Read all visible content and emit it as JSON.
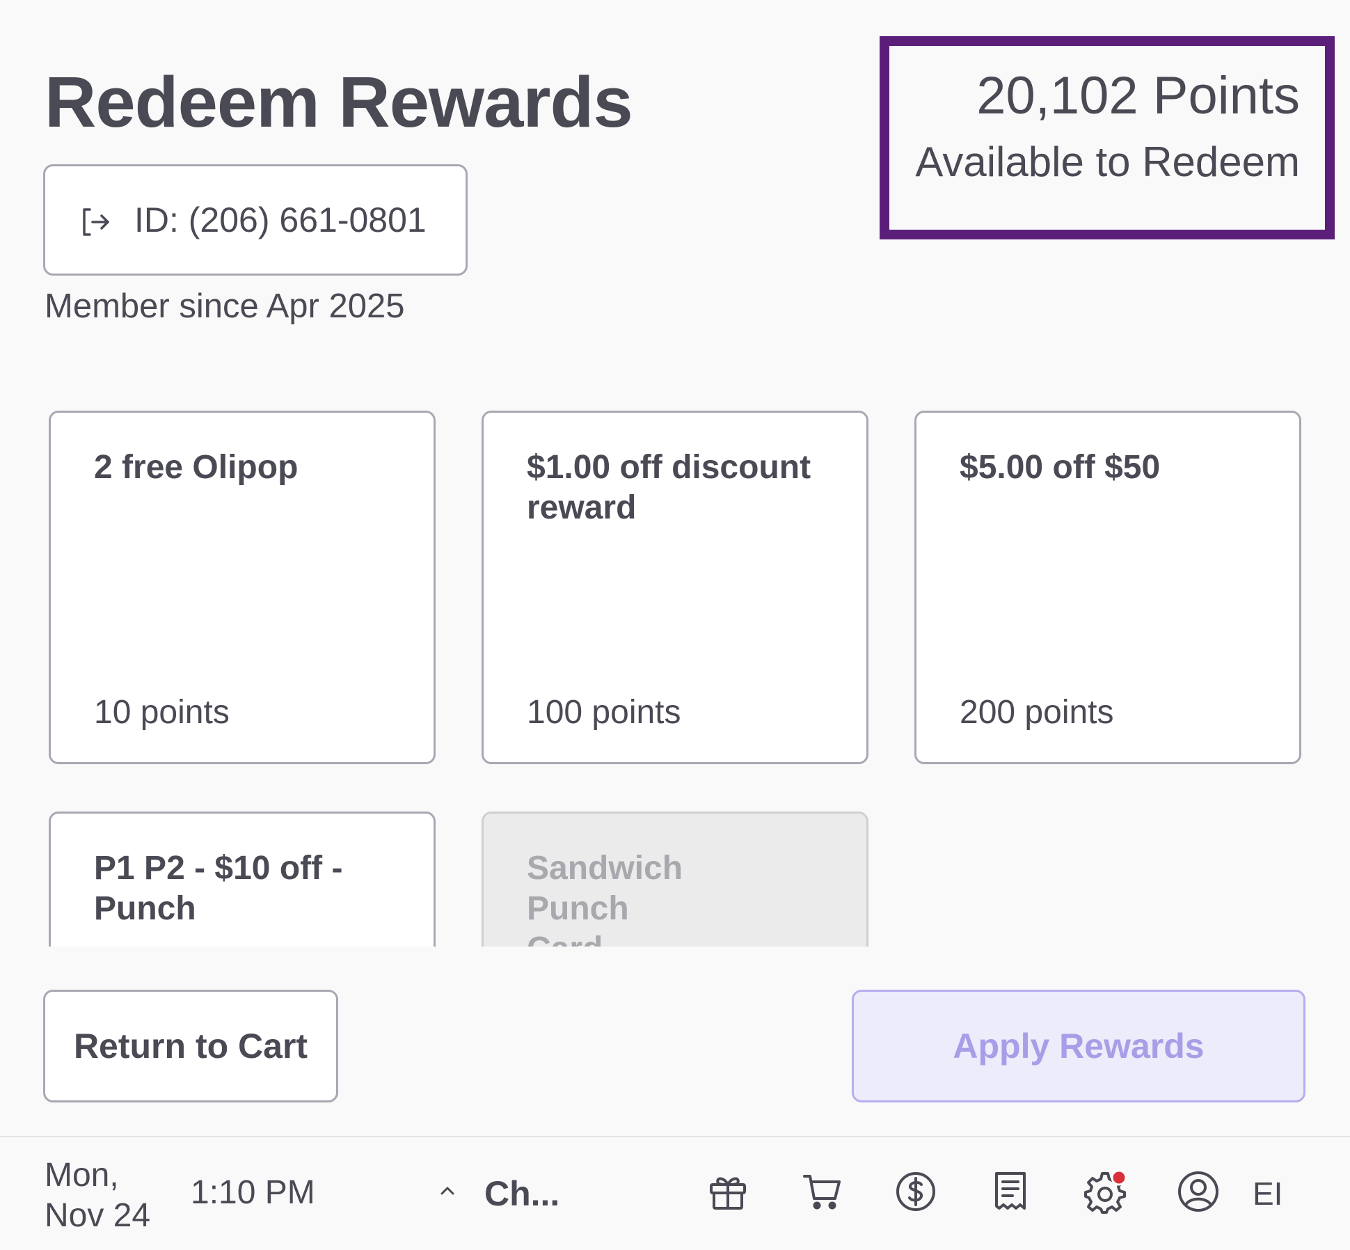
{
  "header": {
    "title": "Redeem Rewards",
    "member_id": "ID: (206) 661-0801",
    "member_since": "Member since Apr 2025"
  },
  "points": {
    "value": "20,102 Points",
    "label": "Available to Redeem",
    "accent_color": "#5b1f7a"
  },
  "rewards": [
    {
      "name": "2 free Olipop",
      "points": "10 points",
      "enabled": true
    },
    {
      "name": "$1.00 off discount reward",
      "points": "100 points",
      "enabled": true
    },
    {
      "name": "$5.00 off $50",
      "points": "200 points",
      "enabled": true
    },
    {
      "name": "P1 P2 - $10 off - Punch",
      "points": "",
      "enabled": true
    },
    {
      "name": "Sandwich Punch Card",
      "points": "",
      "enabled": false
    }
  ],
  "actions": {
    "return_label": "Return to Cart",
    "apply_label": "Apply Rewards"
  },
  "taskbar": {
    "date_line1": "Mon,",
    "date_line2": "Nov 24",
    "time": "1:10 PM",
    "channel": "Ch...",
    "user_initials": "EI",
    "icons": [
      "gift-icon",
      "cart-icon",
      "dollar-icon",
      "receipt-icon",
      "settings-icon",
      "user-icon"
    ],
    "notification_color": "#d9303a"
  }
}
